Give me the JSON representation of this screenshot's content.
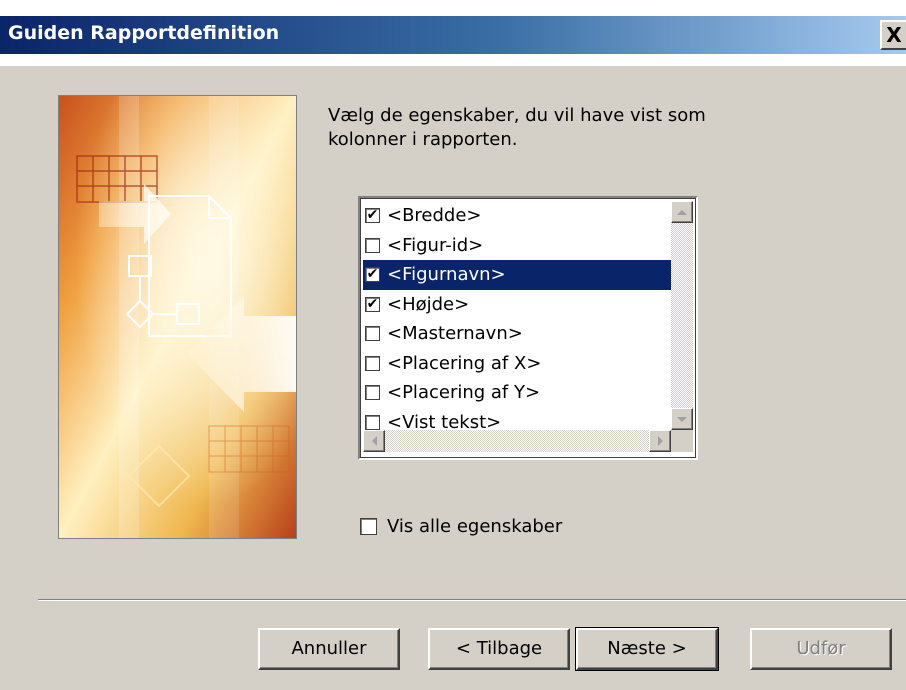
{
  "window": {
    "title": "Guiden Rapportdefinition",
    "close_glyph": "X"
  },
  "instruction": "Vælg de egenskaber, du vil have vist som\nkolonner i rapporten.",
  "properties_list": {
    "items": [
      {
        "label": "<Bredde>",
        "checked": true,
        "selected": false
      },
      {
        "label": "<Figur-id>",
        "checked": false,
        "selected": false
      },
      {
        "label": "<Figurnavn>",
        "checked": true,
        "selected": true
      },
      {
        "label": "<Højde>",
        "checked": true,
        "selected": false
      },
      {
        "label": "<Masternavn>",
        "checked": false,
        "selected": false
      },
      {
        "label": "<Placering af X>",
        "checked": false,
        "selected": false
      },
      {
        "label": "<Placering af Y>",
        "checked": false,
        "selected": false
      },
      {
        "label": "<Vist tekst>",
        "checked": false,
        "selected": false
      }
    ]
  },
  "show_all": {
    "label": "Vis alle egenskaber",
    "checked": false
  },
  "buttons": {
    "cancel": "Annuller",
    "back": "< Tilbage",
    "next": "Næste >",
    "finish": "Udfør"
  },
  "colors": {
    "dialog_bg": "#d4d0c8",
    "title_gradient_start": "#0a246a",
    "title_gradient_end": "#a6caf0",
    "selection": "#0a246a",
    "disabled_text": "#808080"
  },
  "icons": {
    "wizard_image": "report-wizard-illustration",
    "checkmark": "checkmark-icon",
    "scroll_up": "arrow-up-icon",
    "scroll_down": "arrow-down-icon",
    "scroll_left": "arrow-left-icon",
    "scroll_right": "arrow-right-icon"
  }
}
